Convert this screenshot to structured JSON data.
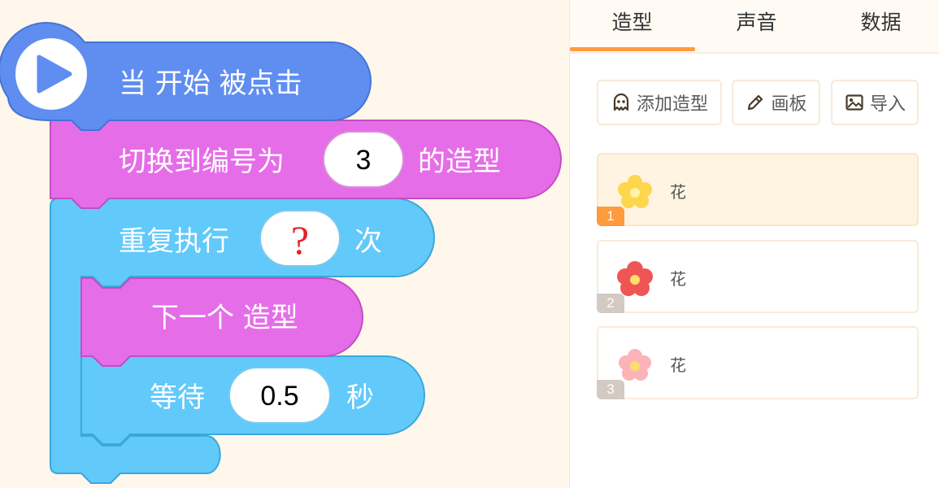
{
  "blocks": {
    "hat_text": "当 开始 被点击",
    "switch_prefix": "切换到编号为",
    "switch_value": "3",
    "switch_suffix": "的造型",
    "repeat_prefix": "重复执行",
    "repeat_value": "?",
    "repeat_suffix": "次",
    "next_costume": "下一个 造型",
    "wait_prefix": "等待",
    "wait_value": "0.5",
    "wait_suffix": "秒"
  },
  "colors": {
    "events": "#5f8ef0",
    "looks": "#e66de8",
    "control": "#62c9fb",
    "accent": "#ff9a3d"
  },
  "tabs": [
    {
      "label": "造型",
      "active": true
    },
    {
      "label": "声音",
      "active": false
    },
    {
      "label": "数据",
      "active": false
    }
  ],
  "toolbar": {
    "add_costume": "添加造型",
    "add_costume_icon": "ghost-icon",
    "paint": "画板",
    "paint_icon": "pencil-icon",
    "import": "导入",
    "import_icon": "image-icon"
  },
  "costumes": [
    {
      "number": "1",
      "name": "花",
      "color": "#fdd64d",
      "selected": true
    },
    {
      "number": "2",
      "name": "花",
      "color": "#f05555",
      "selected": false
    },
    {
      "number": "3",
      "name": "花",
      "color": "#fbb3b8",
      "selected": false
    }
  ]
}
